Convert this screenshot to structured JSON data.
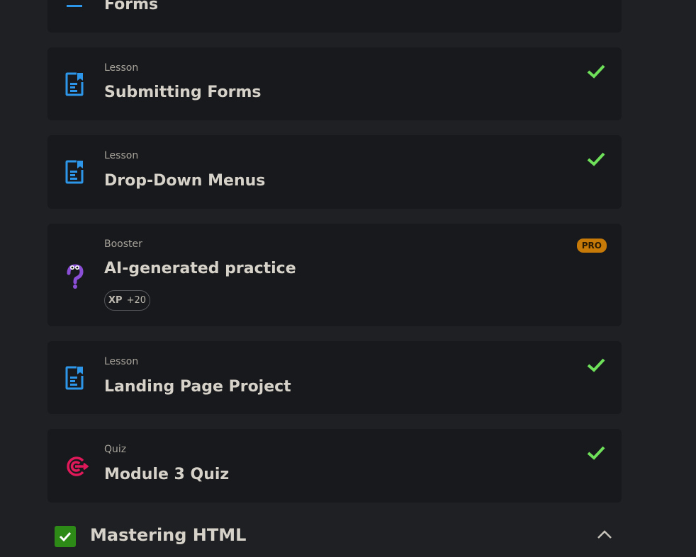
{
  "items": [
    {
      "type": "",
      "title": "Forms",
      "completed": false
    },
    {
      "type": "Lesson",
      "title": "Submitting Forms",
      "completed": true
    },
    {
      "type": "Lesson",
      "title": "Drop-Down Menus",
      "completed": true
    },
    {
      "type": "Booster",
      "title": "AI-generated practice",
      "badge": "PRO",
      "xp_label": "XP",
      "xp_value": "+20"
    },
    {
      "type": "Lesson",
      "title": "Landing Page Project",
      "completed": true
    },
    {
      "type": "Quiz",
      "title": "Module 3 Quiz",
      "completed": true
    }
  ],
  "section": {
    "title": "Mastering HTML",
    "completed": true,
    "expanded": true
  },
  "colors": {
    "check": "#6ee05a",
    "lesson_icon": "#2d96e8",
    "quiz_icon": "#e0195a",
    "booster_icon": "#8a4fd6",
    "pro_badge": "#c77a07",
    "section_check": "#2e8a16"
  }
}
